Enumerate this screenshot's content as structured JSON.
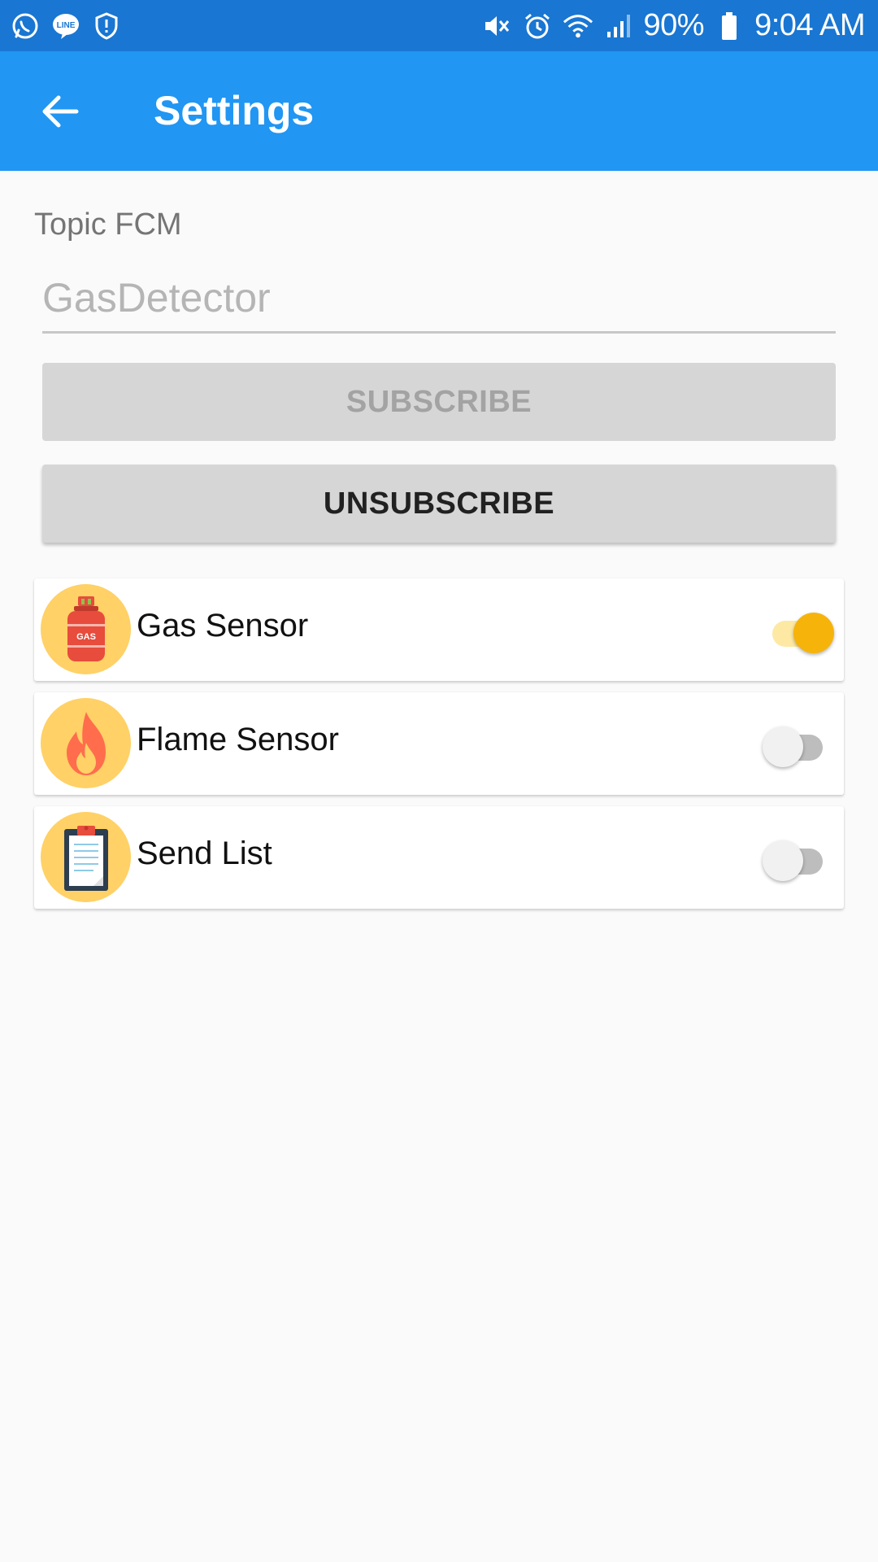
{
  "status_bar": {
    "left_icons": [
      "whatsapp-icon",
      "line-icon",
      "shield-icon"
    ],
    "right_icons": [
      "mute-icon",
      "alarm-icon",
      "wifi-icon",
      "signal-icon",
      "battery-icon"
    ],
    "battery": "90%",
    "time": "9:04 AM"
  },
  "app_bar": {
    "title": "Settings",
    "back_icon": "arrow-back-icon"
  },
  "topic": {
    "label": "Topic FCM",
    "value": "",
    "placeholder": "GasDetector"
  },
  "buttons": {
    "subscribe": "SUBSCRIBE",
    "unsubscribe": "UNSUBSCRIBE"
  },
  "sensors": [
    {
      "label": "Gas Sensor",
      "icon": "gas-cylinder-icon",
      "enabled": true
    },
    {
      "label": "Flame Sensor",
      "icon": "flame-icon",
      "enabled": false
    },
    {
      "label": "Send List",
      "icon": "clipboard-icon",
      "enabled": false
    }
  ],
  "colors": {
    "status_bar": "#1976d2",
    "app_bar": "#2196f3",
    "switch_on": "#f6b40b",
    "icon_circle": "#ffd166"
  }
}
